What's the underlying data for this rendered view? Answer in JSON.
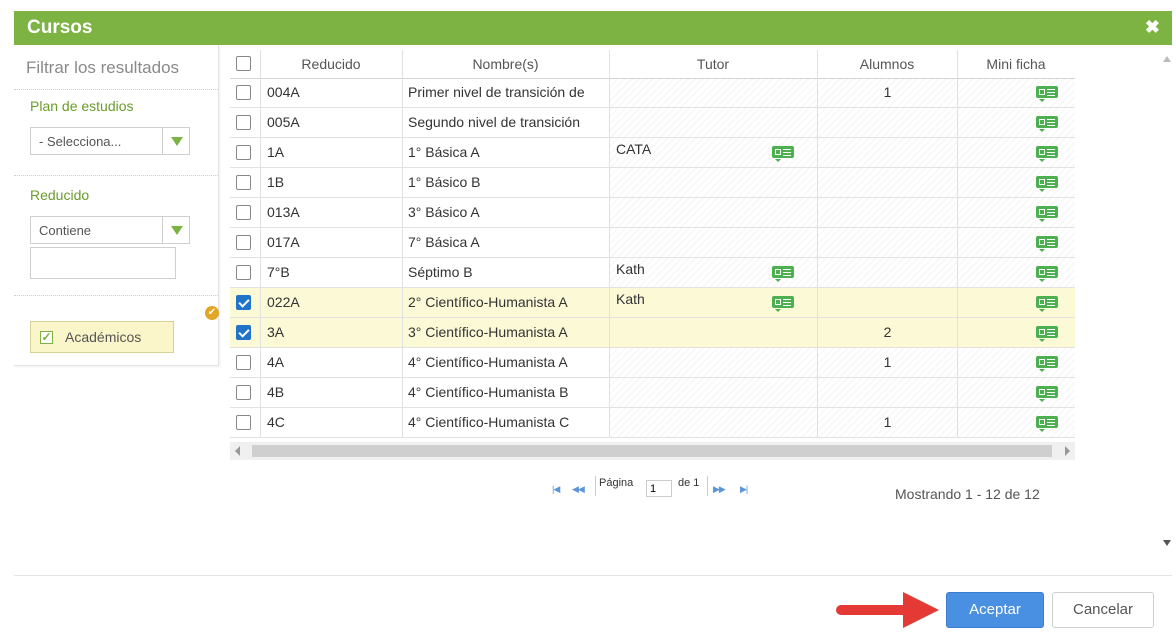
{
  "dialog": {
    "title": "Cursos",
    "close_icon": "close-icon"
  },
  "filter": {
    "title": "Filtrar los resultados",
    "plan_label": "Plan de estudios",
    "plan_value": "- Selecciona...",
    "reducido_label": "Reducido",
    "reducido_mode": "Contiene",
    "reducido_value": "",
    "academicos_label": "Académicos",
    "academicos_checked": true
  },
  "grid": {
    "columns": [
      "Reducido",
      "Nombre(s)",
      "Tutor",
      "Alumnos",
      "Mini ficha"
    ],
    "rows": [
      {
        "reducido": "004A",
        "nombre": "Primer nivel de transición de",
        "tutor": "",
        "tutor_icon": false,
        "alumnos": "1",
        "checked": false
      },
      {
        "reducido": "005A",
        "nombre": "Segundo nivel de transición",
        "tutor": "",
        "tutor_icon": false,
        "alumnos": "",
        "checked": false
      },
      {
        "reducido": "1A",
        "nombre": "1° Básica A",
        "tutor": "CATA",
        "tutor_icon": true,
        "alumnos": "",
        "checked": false
      },
      {
        "reducido": "1B",
        "nombre": "1° Básico B",
        "tutor": "",
        "tutor_icon": false,
        "alumnos": "",
        "checked": false
      },
      {
        "reducido": "013A",
        "nombre": "3° Básico A",
        "tutor": "",
        "tutor_icon": false,
        "alumnos": "",
        "checked": false
      },
      {
        "reducido": "017A",
        "nombre": "7° Básica A",
        "tutor": "",
        "tutor_icon": false,
        "alumnos": "",
        "checked": false
      },
      {
        "reducido": "7°B",
        "nombre": "Séptimo B",
        "tutor": "Kath",
        "tutor_icon": true,
        "alumnos": "",
        "checked": false
      },
      {
        "reducido": "022A",
        "nombre": "2° Científico-Humanista A",
        "tutor": "Kath",
        "tutor_icon": true,
        "alumnos": "",
        "checked": true
      },
      {
        "reducido": "3A",
        "nombre": "3° Científico-Humanista A",
        "tutor": "",
        "tutor_icon": false,
        "alumnos": "2",
        "checked": true
      },
      {
        "reducido": "4A",
        "nombre": "4° Científico-Humanista A",
        "tutor": "",
        "tutor_icon": false,
        "alumnos": "1",
        "checked": false
      },
      {
        "reducido": "4B",
        "nombre": "4° Científico-Humanista B",
        "tutor": "",
        "tutor_icon": false,
        "alumnos": "",
        "checked": false
      },
      {
        "reducido": "4C",
        "nombre": "4° Científico-Humanista C",
        "tutor": "",
        "tutor_icon": false,
        "alumnos": "1",
        "checked": false
      }
    ]
  },
  "pager": {
    "first": "|◀",
    "prev": "◀◀",
    "page_label": "Página",
    "page_value": "1",
    "of_label": "de 1",
    "next": "▶▶",
    "last": "▶|",
    "showing": "Mostrando 1 - 12 de 12"
  },
  "footer": {
    "accept_label": "Aceptar",
    "cancel_label": "Cancelar"
  },
  "colors": {
    "accent": "#7cb342",
    "selected_row": "#fcf9d7",
    "primary_button": "#4a90e2",
    "arrow": "#e53935"
  }
}
